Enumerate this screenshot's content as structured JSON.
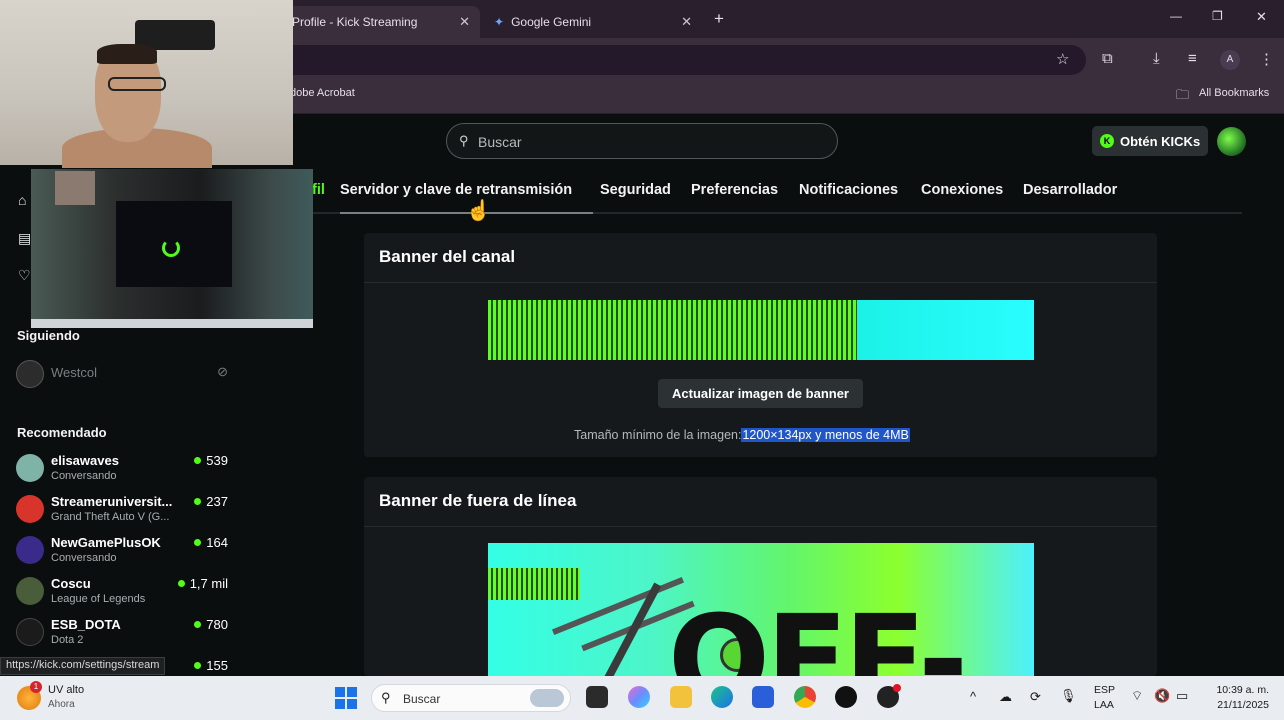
{
  "browser": {
    "tabs": [
      {
        "title": "Profile - Kick Streaming",
        "close": "✕"
      },
      {
        "title": "Google Gemini",
        "close": "✕"
      }
    ],
    "new_tab": "+",
    "window_controls": {
      "minimize": "—",
      "maximize": "❐",
      "close": "✕"
    },
    "profile_initial": "A",
    "bookmarks": {
      "left": "dobe Acrobat",
      "right": "All Bookmarks"
    }
  },
  "header": {
    "search_placeholder": "Buscar",
    "kicks_button": "Obtén KICKs"
  },
  "settings_tabs": [
    "fil",
    "Servidor y clave de retransmisión",
    "Seguridad",
    "Preferencias",
    "Notificaciones",
    "Conexiones",
    "Desarrollador"
  ],
  "channel_banner": {
    "title": "Banner del canal",
    "button": "Actualizar imagen de banner",
    "hint_prefix": "Tamaño mínimo de la imagen:",
    "hint_selected": "1200×134px y menos de 4MB"
  },
  "offline_banner": {
    "title": "Banner de fuera de línea",
    "image_text": "OFF-"
  },
  "sidebar": {
    "following_title": "Siguiendo",
    "following": [
      {
        "name": "Westcol"
      }
    ],
    "recommended_title": "Recomendado",
    "recommended": [
      {
        "name": "elisawaves",
        "category": "Conversando",
        "viewers": "539",
        "color": "#7fb3a7"
      },
      {
        "name": "Streameruniversit...",
        "category": "Grand Theft Auto V (G...",
        "viewers": "237",
        "color": "#d8342b"
      },
      {
        "name": "NewGamePlusOK",
        "category": "Conversando",
        "viewers": "164",
        "color": "#3a2a8a"
      },
      {
        "name": "Coscu",
        "category": "League of Legends",
        "viewers": "1,7 mil",
        "color": "#4a5d3a"
      },
      {
        "name": "ESB_DOTA",
        "category": "Dota 2",
        "viewers": "780",
        "color": "#1b1b1b"
      },
      {
        "name": "",
        "category": "",
        "viewers": "155",
        "color": "#0b0e0f"
      }
    ],
    "status_url": "https://kick.com/settings/stream"
  },
  "taskbar": {
    "weather_badge": "1",
    "weather_title": "UV alto",
    "weather_sub": "Ahora",
    "search_placeholder": "Buscar",
    "lang_top": "ESP",
    "lang_bottom": "LAA",
    "time": "10:39 a. m.",
    "date": "21/11/2025"
  }
}
